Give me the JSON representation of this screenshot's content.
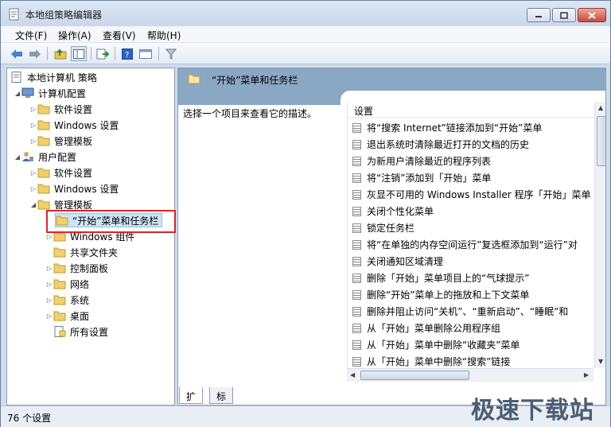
{
  "window": {
    "title": "本地组策略编辑器"
  },
  "menubar": [
    "文件(F)",
    "操作(A)",
    "查看(V)",
    "帮助(H)"
  ],
  "tree": {
    "root": "本地计算机 策略",
    "computer": "计算机配置",
    "computer_children": [
      "软件设置",
      "Windows 设置",
      "管理模板"
    ],
    "user": "用户配置",
    "user_children": [
      "软件设置",
      "Windows 设置",
      "管理模板"
    ],
    "admin_children": [
      "“开始”菜单和任务栏",
      "Windows 组件",
      "共享文件夹",
      "控制面板",
      "网络",
      "系统",
      "桌面",
      "所有设置"
    ]
  },
  "right": {
    "header": "“开始”菜单和任务栏",
    "description": "选择一个项目来查看它的描述。",
    "column": "设置",
    "items": [
      "将“搜索 Internet”链接添加到“开始”菜单",
      "退出系统时清除最近打开的文档的历史",
      "为新用户清除最近的程序列表",
      "将“注销”添加到「开始」菜单",
      "灰显不可用的 Windows Installer 程序「开始」菜单",
      "关闭个性化菜单",
      "锁定任务栏",
      "将“在单独的内存空间运行”复选框添加到“运行”对",
      "关闭通知区域清理",
      "删除「开始」菜单项目上的“气球提示”",
      "删除“开始”菜单上的拖放和上下文菜单",
      "删除并阻止访问“关机”、“重新启动”、“睡眠”和",
      "从「开始」菜单删除公用程序组",
      "从「开始」菜单中删除“收藏夹”菜单",
      "从「开始」菜单中删除“搜索”链接"
    ]
  },
  "tabs": [
    "扩展",
    "标准"
  ],
  "status": "76 个设置",
  "watermark": "极速下载站"
}
